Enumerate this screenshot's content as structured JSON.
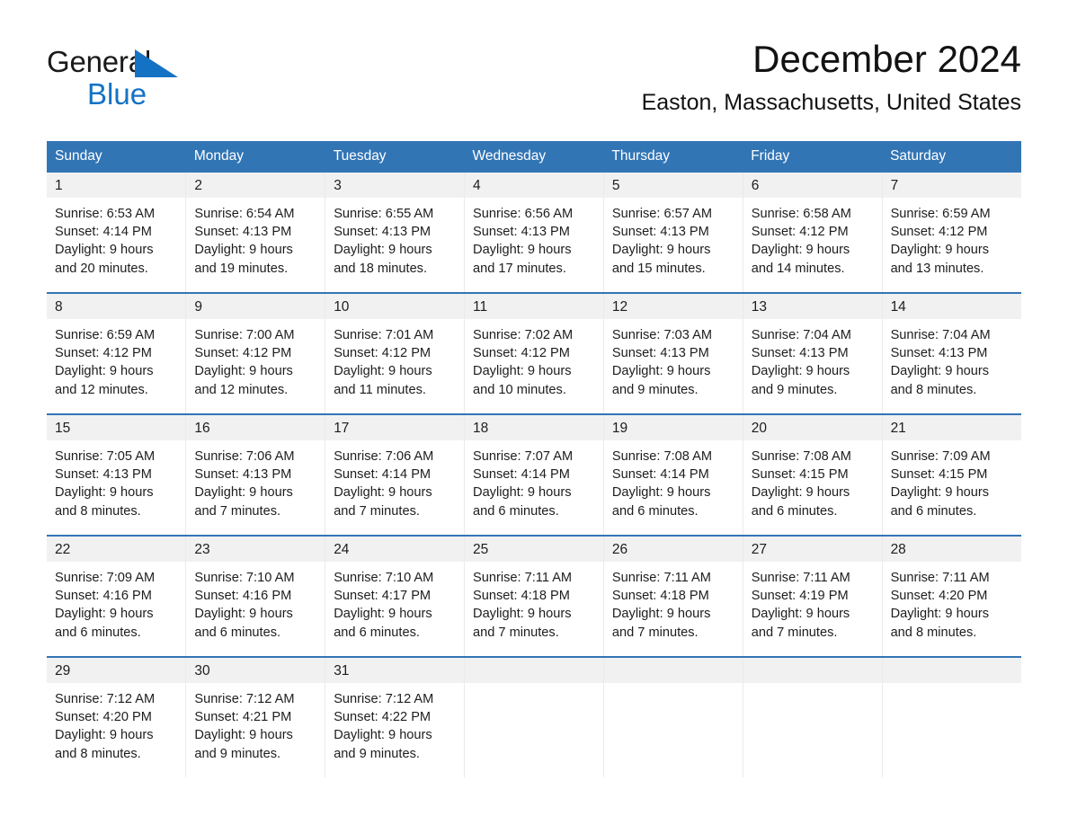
{
  "brand": {
    "name_part1": "General",
    "name_part2": "Blue",
    "mark": "triangle-logo-icon",
    "accent_color": "#1472c4"
  },
  "header": {
    "title": "December 2024",
    "location": "Easton, Massachusetts, United States"
  },
  "calendar": {
    "header_color": "#3275b5",
    "daynum_band_color": "#f1f1f1",
    "weekday_headers": [
      "Sunday",
      "Monday",
      "Tuesday",
      "Wednesday",
      "Thursday",
      "Friday",
      "Saturday"
    ],
    "weeks": [
      [
        {
          "day": "1",
          "sunrise": "Sunrise: 6:53 AM",
          "sunset": "Sunset: 4:14 PM",
          "daylight1": "Daylight: 9 hours",
          "daylight2": "and 20 minutes."
        },
        {
          "day": "2",
          "sunrise": "Sunrise: 6:54 AM",
          "sunset": "Sunset: 4:13 PM",
          "daylight1": "Daylight: 9 hours",
          "daylight2": "and 19 minutes."
        },
        {
          "day": "3",
          "sunrise": "Sunrise: 6:55 AM",
          "sunset": "Sunset: 4:13 PM",
          "daylight1": "Daylight: 9 hours",
          "daylight2": "and 18 minutes."
        },
        {
          "day": "4",
          "sunrise": "Sunrise: 6:56 AM",
          "sunset": "Sunset: 4:13 PM",
          "daylight1": "Daylight: 9 hours",
          "daylight2": "and 17 minutes."
        },
        {
          "day": "5",
          "sunrise": "Sunrise: 6:57 AM",
          "sunset": "Sunset: 4:13 PM",
          "daylight1": "Daylight: 9 hours",
          "daylight2": "and 15 minutes."
        },
        {
          "day": "6",
          "sunrise": "Sunrise: 6:58 AM",
          "sunset": "Sunset: 4:12 PM",
          "daylight1": "Daylight: 9 hours",
          "daylight2": "and 14 minutes."
        },
        {
          "day": "7",
          "sunrise": "Sunrise: 6:59 AM",
          "sunset": "Sunset: 4:12 PM",
          "daylight1": "Daylight: 9 hours",
          "daylight2": "and 13 minutes."
        }
      ],
      [
        {
          "day": "8",
          "sunrise": "Sunrise: 6:59 AM",
          "sunset": "Sunset: 4:12 PM",
          "daylight1": "Daylight: 9 hours",
          "daylight2": "and 12 minutes."
        },
        {
          "day": "9",
          "sunrise": "Sunrise: 7:00 AM",
          "sunset": "Sunset: 4:12 PM",
          "daylight1": "Daylight: 9 hours",
          "daylight2": "and 12 minutes."
        },
        {
          "day": "10",
          "sunrise": "Sunrise: 7:01 AM",
          "sunset": "Sunset: 4:12 PM",
          "daylight1": "Daylight: 9 hours",
          "daylight2": "and 11 minutes."
        },
        {
          "day": "11",
          "sunrise": "Sunrise: 7:02 AM",
          "sunset": "Sunset: 4:12 PM",
          "daylight1": "Daylight: 9 hours",
          "daylight2": "and 10 minutes."
        },
        {
          "day": "12",
          "sunrise": "Sunrise: 7:03 AM",
          "sunset": "Sunset: 4:13 PM",
          "daylight1": "Daylight: 9 hours",
          "daylight2": "and 9 minutes."
        },
        {
          "day": "13",
          "sunrise": "Sunrise: 7:04 AM",
          "sunset": "Sunset: 4:13 PM",
          "daylight1": "Daylight: 9 hours",
          "daylight2": "and 9 minutes."
        },
        {
          "day": "14",
          "sunrise": "Sunrise: 7:04 AM",
          "sunset": "Sunset: 4:13 PM",
          "daylight1": "Daylight: 9 hours",
          "daylight2": "and 8 minutes."
        }
      ],
      [
        {
          "day": "15",
          "sunrise": "Sunrise: 7:05 AM",
          "sunset": "Sunset: 4:13 PM",
          "daylight1": "Daylight: 9 hours",
          "daylight2": "and 8 minutes."
        },
        {
          "day": "16",
          "sunrise": "Sunrise: 7:06 AM",
          "sunset": "Sunset: 4:13 PM",
          "daylight1": "Daylight: 9 hours",
          "daylight2": "and 7 minutes."
        },
        {
          "day": "17",
          "sunrise": "Sunrise: 7:06 AM",
          "sunset": "Sunset: 4:14 PM",
          "daylight1": "Daylight: 9 hours",
          "daylight2": "and 7 minutes."
        },
        {
          "day": "18",
          "sunrise": "Sunrise: 7:07 AM",
          "sunset": "Sunset: 4:14 PM",
          "daylight1": "Daylight: 9 hours",
          "daylight2": "and 6 minutes."
        },
        {
          "day": "19",
          "sunrise": "Sunrise: 7:08 AM",
          "sunset": "Sunset: 4:14 PM",
          "daylight1": "Daylight: 9 hours",
          "daylight2": "and 6 minutes."
        },
        {
          "day": "20",
          "sunrise": "Sunrise: 7:08 AM",
          "sunset": "Sunset: 4:15 PM",
          "daylight1": "Daylight: 9 hours",
          "daylight2": "and 6 minutes."
        },
        {
          "day": "21",
          "sunrise": "Sunrise: 7:09 AM",
          "sunset": "Sunset: 4:15 PM",
          "daylight1": "Daylight: 9 hours",
          "daylight2": "and 6 minutes."
        }
      ],
      [
        {
          "day": "22",
          "sunrise": "Sunrise: 7:09 AM",
          "sunset": "Sunset: 4:16 PM",
          "daylight1": "Daylight: 9 hours",
          "daylight2": "and 6 minutes."
        },
        {
          "day": "23",
          "sunrise": "Sunrise: 7:10 AM",
          "sunset": "Sunset: 4:16 PM",
          "daylight1": "Daylight: 9 hours",
          "daylight2": "and 6 minutes."
        },
        {
          "day": "24",
          "sunrise": "Sunrise: 7:10 AM",
          "sunset": "Sunset: 4:17 PM",
          "daylight1": "Daylight: 9 hours",
          "daylight2": "and 6 minutes."
        },
        {
          "day": "25",
          "sunrise": "Sunrise: 7:11 AM",
          "sunset": "Sunset: 4:18 PM",
          "daylight1": "Daylight: 9 hours",
          "daylight2": "and 7 minutes."
        },
        {
          "day": "26",
          "sunrise": "Sunrise: 7:11 AM",
          "sunset": "Sunset: 4:18 PM",
          "daylight1": "Daylight: 9 hours",
          "daylight2": "and 7 minutes."
        },
        {
          "day": "27",
          "sunrise": "Sunrise: 7:11 AM",
          "sunset": "Sunset: 4:19 PM",
          "daylight1": "Daylight: 9 hours",
          "daylight2": "and 7 minutes."
        },
        {
          "day": "28",
          "sunrise": "Sunrise: 7:11 AM",
          "sunset": "Sunset: 4:20 PM",
          "daylight1": "Daylight: 9 hours",
          "daylight2": "and 8 minutes."
        }
      ],
      [
        {
          "day": "29",
          "sunrise": "Sunrise: 7:12 AM",
          "sunset": "Sunset: 4:20 PM",
          "daylight1": "Daylight: 9 hours",
          "daylight2": "and 8 minutes."
        },
        {
          "day": "30",
          "sunrise": "Sunrise: 7:12 AM",
          "sunset": "Sunset: 4:21 PM",
          "daylight1": "Daylight: 9 hours",
          "daylight2": "and 9 minutes."
        },
        {
          "day": "31",
          "sunrise": "Sunrise: 7:12 AM",
          "sunset": "Sunset: 4:22 PM",
          "daylight1": "Daylight: 9 hours",
          "daylight2": "and 9 minutes."
        },
        {
          "day": "",
          "sunrise": "",
          "sunset": "",
          "daylight1": "",
          "daylight2": ""
        },
        {
          "day": "",
          "sunrise": "",
          "sunset": "",
          "daylight1": "",
          "daylight2": ""
        },
        {
          "day": "",
          "sunrise": "",
          "sunset": "",
          "daylight1": "",
          "daylight2": ""
        },
        {
          "day": "",
          "sunrise": "",
          "sunset": "",
          "daylight1": "",
          "daylight2": ""
        }
      ]
    ]
  }
}
